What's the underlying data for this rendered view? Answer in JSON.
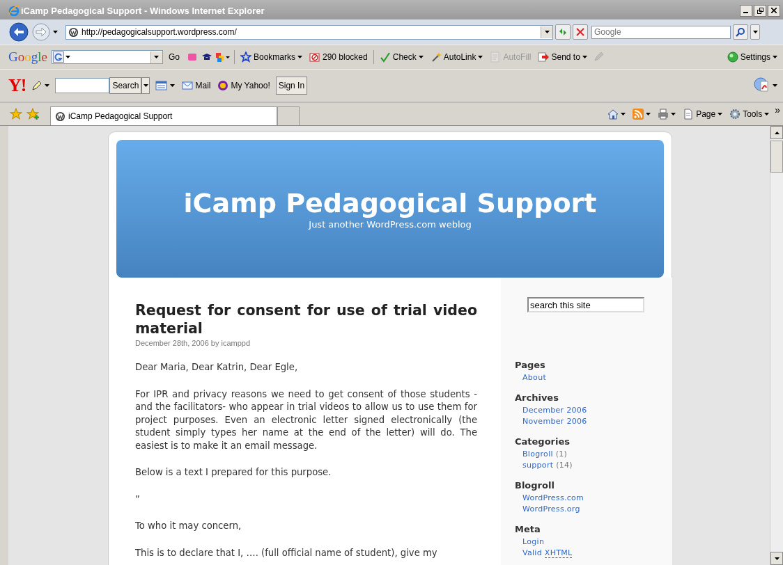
{
  "window": {
    "title": "iCamp Pedagogical Support - Windows Internet Explorer"
  },
  "address_bar": {
    "url": "http://pedagogicalsupport.wordpress.com/"
  },
  "search_box": {
    "placeholder": "Google"
  },
  "google_toolbar": {
    "logo": "Google",
    "go": "Go",
    "items": [
      {
        "label": "Bookmarks",
        "kind": "dropdown",
        "disabled": false
      },
      {
        "label": "290 blocked",
        "kind": "button",
        "disabled": false
      },
      {
        "label": "Check",
        "kind": "dropdown",
        "disabled": false
      },
      {
        "label": "AutoLink",
        "kind": "dropdown",
        "disabled": false
      },
      {
        "label": "AutoFill",
        "kind": "button",
        "disabled": true
      },
      {
        "label": "Send to",
        "kind": "dropdown",
        "disabled": false
      }
    ],
    "settings": "Settings"
  },
  "yahoo_toolbar": {
    "logo": "Y!",
    "search_button": "Search",
    "items": [
      {
        "label": "Mail"
      },
      {
        "label": "My Yahoo!"
      }
    ],
    "sign_in": "Sign In"
  },
  "tabs": [
    {
      "label": "iCamp Pedagogical Support",
      "selected": true
    }
  ],
  "command_bar": [
    {
      "label": "Page"
    },
    {
      "label": "Tools"
    }
  ],
  "more": "»",
  "blog": {
    "title": "iCamp Pedagogical Support",
    "tagline": "Just another WordPress.com weblog"
  },
  "post": {
    "title": "Request for consent for use of trial video material",
    "meta": "December 28th, 2006 by icamppd",
    "paragraphs": [
      "Dear Maria, Dear Katrin, Dear Egle,",
      "For IPR and privacy reasons we need to get consent of those students -and the facilitators- who appear in trial videos to allow us to use them for project purposes. Even an electronic letter signed electronically (the student simply types her name at the end of the letter) will do. The easiest is to make it an email message.",
      "Below is a text I prepared for this purpose.",
      "”",
      "To who it may concern,",
      "This is to declare that I, …. (full official name of student), give my"
    ]
  },
  "sidebar": {
    "search_value": "search this site",
    "sections": [
      {
        "heading": "Pages",
        "links": [
          {
            "label": "About"
          }
        ]
      },
      {
        "heading": "Archives",
        "links": [
          {
            "label": "December 2006"
          },
          {
            "label": "November 2006"
          }
        ]
      },
      {
        "heading": "Categories",
        "links": [
          {
            "label": "Blogroll",
            "count": "(1)"
          },
          {
            "label": "support",
            "count": "(14)"
          }
        ]
      },
      {
        "heading": "Blogroll",
        "links": [
          {
            "label": "WordPress.com"
          },
          {
            "label": "WordPress.org"
          }
        ]
      },
      {
        "heading": "Meta",
        "links": [
          {
            "label": "Login"
          },
          {
            "label": "Valid",
            "abbr": "XHTML"
          }
        ]
      }
    ]
  }
}
